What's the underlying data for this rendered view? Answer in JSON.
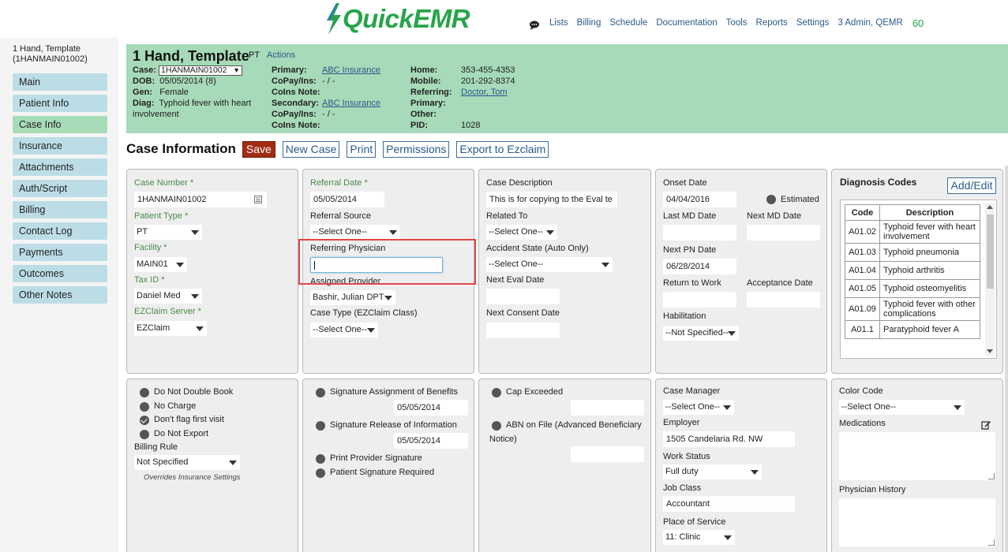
{
  "app": {
    "logo": "QuickEMR"
  },
  "nav": {
    "items": [
      "Lists",
      "Billing",
      "Schedule",
      "Documentation",
      "Tools",
      "Reports",
      "Settings",
      "3 Admin, QEMR"
    ],
    "count": "60"
  },
  "sidebar": {
    "patient_line1": "1 Hand, Template",
    "patient_line2": "(1HANMAIN01002)",
    "items": [
      "Main",
      "Patient Info",
      "Case Info",
      "Insurance",
      "Attachments",
      "Auth/Script",
      "Billing",
      "Contact Log",
      "Payments",
      "Outcomes",
      "Other Notes"
    ],
    "active": "Case Info"
  },
  "patient": {
    "name": "1 Hand, Template",
    "type": "PT",
    "actions": "Actions",
    "case_label": "Case:",
    "case_value": "1HANMAIN01002",
    "dob_label": "DOB:",
    "dob_value": "05/05/2014 (8)",
    "gen_label": "Gen:",
    "gen_value": "Female",
    "diag_label": "Diag:",
    "diag_value_1": "Typhoid fever with heart",
    "diag_value_2": "involvement",
    "primary_label": "Primary:",
    "primary_value": "ABC Insurance",
    "copay1_label": "CoPay/Ins:",
    "copay1_value": "- / -",
    "coins1_label": "CoIns Note:",
    "secondary_label": "Secondary:",
    "secondary_value": "ABC Insurance",
    "copay2_label": "CoPay/Ins:",
    "copay2_value": "- / -",
    "coins2_label": "CoIns Note:",
    "home_label": "Home:",
    "home_value": "353-455-4353",
    "mobile_label": "Mobile:",
    "mobile_value": "201-292-8374",
    "referring_label": "Referring:",
    "referring_value": "Doctor, Tom",
    "primary2_label": "Primary:",
    "other_label": "Other:",
    "pid_label": "PID:",
    "pid_value": "1028"
  },
  "page": {
    "title": "Case Information",
    "buttons": {
      "save": "Save",
      "new_case": "New Case",
      "print": "Print",
      "permissions": "Permissions",
      "export": "Export to Ezclaim"
    }
  },
  "col1": {
    "case_number_label": "Case Number *",
    "case_number_value": "1HANMAIN01002",
    "patient_type_label": "Patient Type *",
    "patient_type_value": "PT",
    "facility_label": "Facility *",
    "facility_value": "MAIN01",
    "tax_id_label": "Tax ID *",
    "tax_id_value": "Daniel Med",
    "ezclaim_label": "EZClaim Server *",
    "ezclaim_value": "EZClaim"
  },
  "col2": {
    "referral_date_label": "Referral Date *",
    "referral_date_value": "05/05/2014",
    "referral_source_label": "Referral Source",
    "referral_source_value": "--Select One--",
    "referring_physician_label": "Referring Physician",
    "referring_physician_value": "",
    "assigned_provider_label": "Assigned Provider",
    "assigned_provider_value": "Bashir, Julian DPT",
    "case_type_label": "Case Type (EZClaim Class)",
    "case_type_value": "--Select One--"
  },
  "col3": {
    "case_description_label": "Case Description",
    "case_description_value": "This is for copying to the Eval te",
    "related_to_label": "Related To",
    "related_to_value": "--Select One--",
    "accident_state_label": "Accident State (Auto Only)",
    "accident_state_value": "--Select One--",
    "next_eval_label": "Next Eval Date",
    "next_consent_label": "Next Consent Date"
  },
  "col4": {
    "onset_label": "Onset Date",
    "onset_value": "04/04/2016",
    "estimated_label": "Estimated",
    "last_md_label": "Last MD Date",
    "next_md_label": "Next MD Date",
    "next_pn_label": "Next PN Date",
    "next_pn_value": "06/28/2014",
    "return_work_label": "Return to Work",
    "acceptance_label": "Acceptance Date",
    "habilitation_label": "Habilitation",
    "habilitation_value": "--Not Specified--"
  },
  "diagnosis": {
    "title": "Diagnosis Codes",
    "add_edit": "Add/Edit",
    "col_code": "Code",
    "col_desc": "Description",
    "rows": [
      {
        "code": "A01.02",
        "desc": "Typhoid fever with heart involvement"
      },
      {
        "code": "A01.03",
        "desc": "Typhoid pneumonia"
      },
      {
        "code": "A01.04",
        "desc": "Typhoid arthritis"
      },
      {
        "code": "A01.05",
        "desc": "Typhoid osteomyelitis"
      },
      {
        "code": "A01.09",
        "desc": "Typhoid fever with other complications"
      },
      {
        "code": "A01.1",
        "desc": "Paratyphoid fever A"
      }
    ]
  },
  "bottom1": {
    "no_double_book": "Do Not Double Book",
    "no_charge": "No Charge",
    "dont_flag": "Don't flag first visit",
    "no_export": "Do Not Export",
    "billing_rule_label": "Billing Rule",
    "billing_rule_value": "Not Specified",
    "overrides_note": "Overrides Insurance Settings"
  },
  "bottom2": {
    "sig_assign": "Signature Assignment of Benefits",
    "sig_assign_date": "05/05/2014",
    "sig_release": "Signature Release of Information",
    "sig_release_date": "05/05/2014",
    "print_provider": "Print Provider Signature",
    "patient_sig": "Patient Signature Required"
  },
  "bottom3": {
    "cap_exceeded": "Cap Exceeded",
    "abn_line1": "ABN on File (Advanced Beneficiary",
    "abn_line2": "Notice)"
  },
  "bottom4": {
    "case_manager_label": "Case Manager",
    "case_manager_value": "--Select One--",
    "employer_label": "Employer",
    "employer_value": "1505 Candelaria Rd. NW",
    "work_status_label": "Work Status",
    "work_status_value": "Full duty",
    "job_class_label": "Job Class",
    "job_class_value": "Accountant",
    "place_service_label": "Place of Service",
    "place_service_value": "11: Clinic"
  },
  "bottom5": {
    "color_code_label": "Color Code",
    "color_code_value": "--Select One--",
    "medications_label": "Medications",
    "physician_history_label": "Physician History"
  }
}
